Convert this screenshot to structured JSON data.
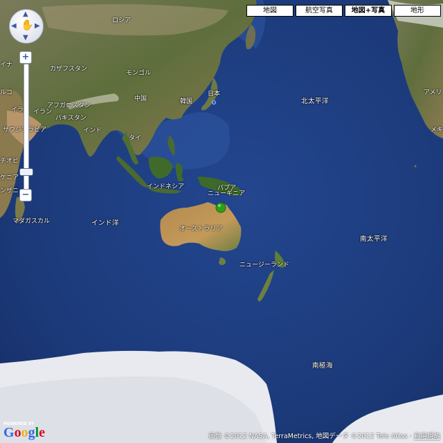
{
  "map_types": {
    "map": "地図",
    "satellite": "航空写真",
    "hybrid": "地図+写真",
    "terrain": "地形",
    "selected": "hybrid"
  },
  "zoom": {
    "in": "+",
    "out": "−"
  },
  "labels": {
    "russia": "ロシア",
    "kazakhstan": "カザフスタン",
    "mongolia": "モンゴル",
    "china": "中国",
    "korea": "韓国",
    "japan": "日本",
    "north_pacific": "北太平洋",
    "afghanistan": "アフガニスタン",
    "pakistan": "パキスタン",
    "iran": "イラン",
    "iraq_cut": "イラ",
    "turkey_cut": "ルコ",
    "ukraine_cut": "イナ",
    "saudi": "サウジアラビア",
    "india": "インド",
    "thailand": "タイ",
    "ethiopia_cut": "チオピ",
    "kenya": "ケニア",
    "tanzania_cut": "ンザニ",
    "indonesia": "インドネシア",
    "papua": "パプア",
    "new_guinea": "ニューギニア",
    "australia": "オーストラリア",
    "indian_ocean": "インド洋",
    "madagascar": "マダガスカル",
    "new_zealand": "ニュージーランド",
    "south_pacific": "南太平洋",
    "southern_ocean": "南極海",
    "america_cut": "アメリ",
    "mexico_cut": "メキ"
  },
  "logo": {
    "powered_by": "POWERED BY",
    "google": "Google"
  },
  "copyright": {
    "text": "画像 ©2012 NASA, TerraMetrics, 地図データ ©2012 Tele Atlas - ",
    "terms": "利用規約"
  },
  "colors": {
    "ocean": "#1f3d85",
    "marker": "#2e9e1a",
    "selected_pin": "#2255ff"
  }
}
